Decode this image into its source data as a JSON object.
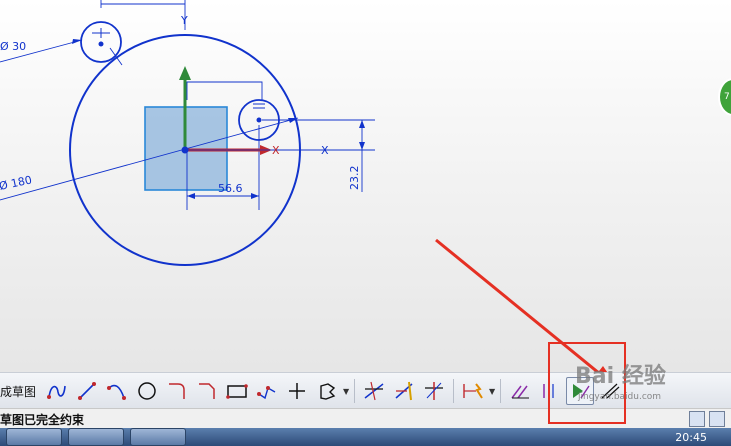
{
  "sketch": {
    "dim_small_circle": "Ø 30",
    "dim_large_circle": "Ø 180",
    "dim_horizontal": "56.6",
    "dim_vertical": "23.2",
    "axis_x": "X",
    "axis_x2": "X",
    "axis_y": "Y",
    "colors": {
      "sketch": "#1133cc",
      "rect_fill": "#9dbfe0",
      "x_axis": "#c0282d",
      "y_axis": "#2f8a3a"
    }
  },
  "toolbar": {
    "label": "成草图",
    "tools": [
      "profile-icon",
      "line-icon",
      "arc-icon",
      "circle-icon",
      "fillet-icon",
      "chamfer-icon",
      "rectangle-icon",
      "polygon-icon",
      "point-icon",
      "offset-curve-icon",
      "quick-trim-icon",
      "quick-extend-icon",
      "make-corner-icon",
      "rapid-dimension-icon",
      "geometric-constraint-icon",
      "auto-constrain-icon",
      "show-constraints-icon",
      "finish-sketch-icon"
    ]
  },
  "status": {
    "message": "草图已完全约束"
  },
  "taskbar": {
    "clock": "20:45"
  },
  "watermark": {
    "main": "Bai 经验",
    "sub": "jingyan.baidu.com"
  },
  "badge": {
    "text": "7"
  }
}
